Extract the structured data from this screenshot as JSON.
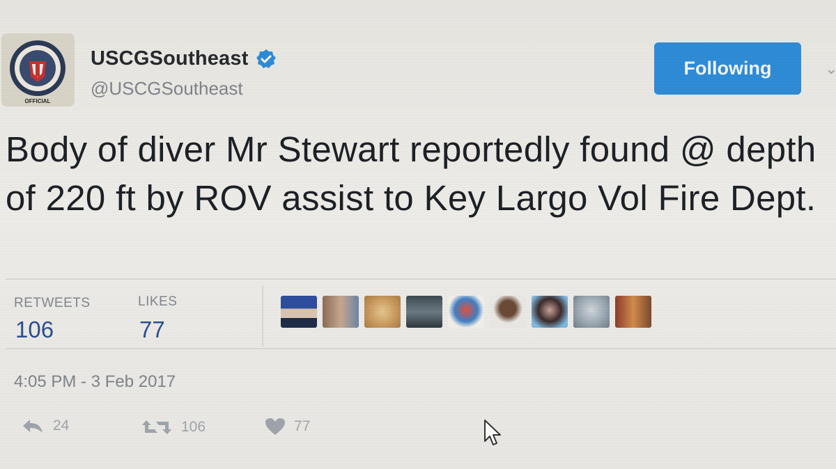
{
  "header": {
    "display_name": "USCGSoutheast",
    "handle": "@USCGSoutheast",
    "follow_label": "Following",
    "avatar_text": "OFFICIAL"
  },
  "tweet": {
    "text": "Body of diver Mr Stewart reportedly found @ depth of 220 ft by ROV assist to Key Largo Vol Fire Dept."
  },
  "stats": {
    "retweets_label": "RETWEETS",
    "retweets_value": "106",
    "likes_label": "LIKES",
    "likes_value": "77"
  },
  "timestamp": "4:05 PM - 3 Feb 2017",
  "actions": {
    "reply_count": "24",
    "retweet_count": "106",
    "like_count": "77"
  },
  "colors": {
    "accent": "#2f8bd6",
    "verified": "#2f8bd6",
    "stat_value": "#2b4f8f"
  },
  "icons": {
    "reply": "reply-icon",
    "retweet": "retweet-icon",
    "like": "heart-icon",
    "verified": "verified-badge-icon",
    "cursor": "mouse-pointer-icon"
  }
}
